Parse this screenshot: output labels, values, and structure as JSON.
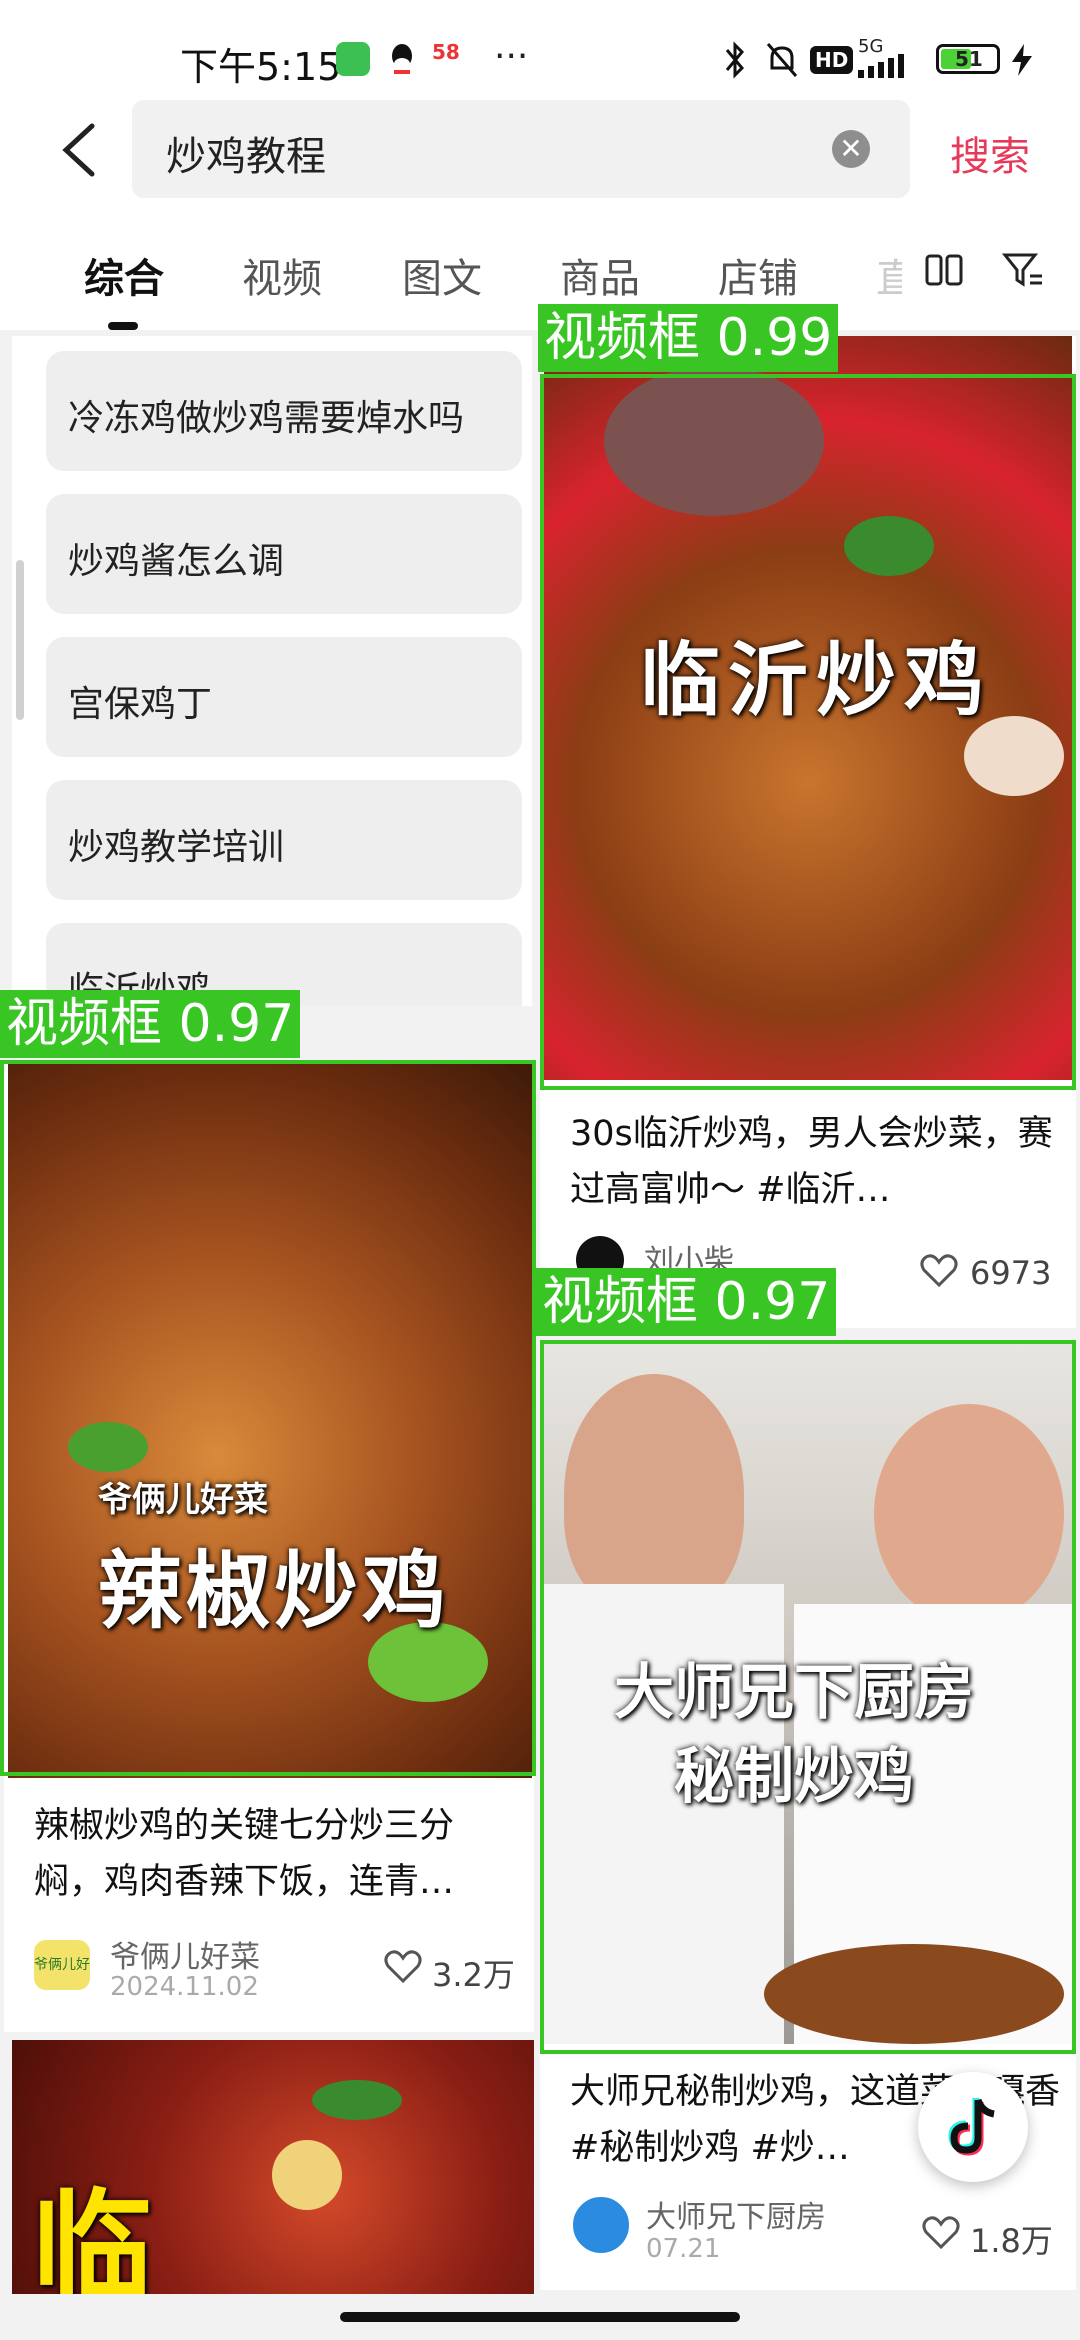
{
  "status_bar": {
    "time": "下午5:15",
    "app_badge": "58",
    "more": "···",
    "network": "5G",
    "hd": "HD",
    "battery": "51"
  },
  "search": {
    "query": "炒鸡教程",
    "button_label": "搜索"
  },
  "tabs": [
    "综合",
    "视频",
    "图文",
    "商品",
    "店铺",
    "直"
  ],
  "suggestions": [
    "冷冻鸡做炒鸡需要焯水吗",
    "炒鸡酱怎么调",
    "宫保鸡丁",
    "炒鸡教学培训",
    "临沂炒鸡"
  ],
  "cards": {
    "card1": {
      "overlay": "临沂炒鸡",
      "title": "30s临沂炒鸡，男人会炒菜，赛过高富帅～ #临沂…",
      "author": "刘小柴",
      "likes": "6973"
    },
    "card2": {
      "overlay_small": "爷俩儿好菜",
      "overlay": "辣椒炒鸡",
      "title": "辣椒炒鸡的关键七分炒三分焖，鸡肉香辣下饭，连青…",
      "author": "爷俩儿好菜",
      "avatar_text": "爷俩儿好菜",
      "date": "2024.11.02",
      "likes": "3.2万"
    },
    "card3": {
      "overlay_line1": "大师兄下厨房",
      "overlay_line2": "秘制炒鸡",
      "title": "大师兄秘制炒鸡，这道菜嘎嘎香 #秘制炒鸡 #炒…",
      "author": "大师兄下厨房",
      "date": "07.21",
      "likes": "1.8万"
    },
    "card4": {
      "overlay": "临"
    }
  },
  "detections": [
    {
      "label": "视频框 0.99"
    },
    {
      "label": "视频框 0.97"
    },
    {
      "label": "视频框 0.97"
    }
  ],
  "colors": {
    "accent": "#e8395a",
    "detection": "#39c624"
  }
}
